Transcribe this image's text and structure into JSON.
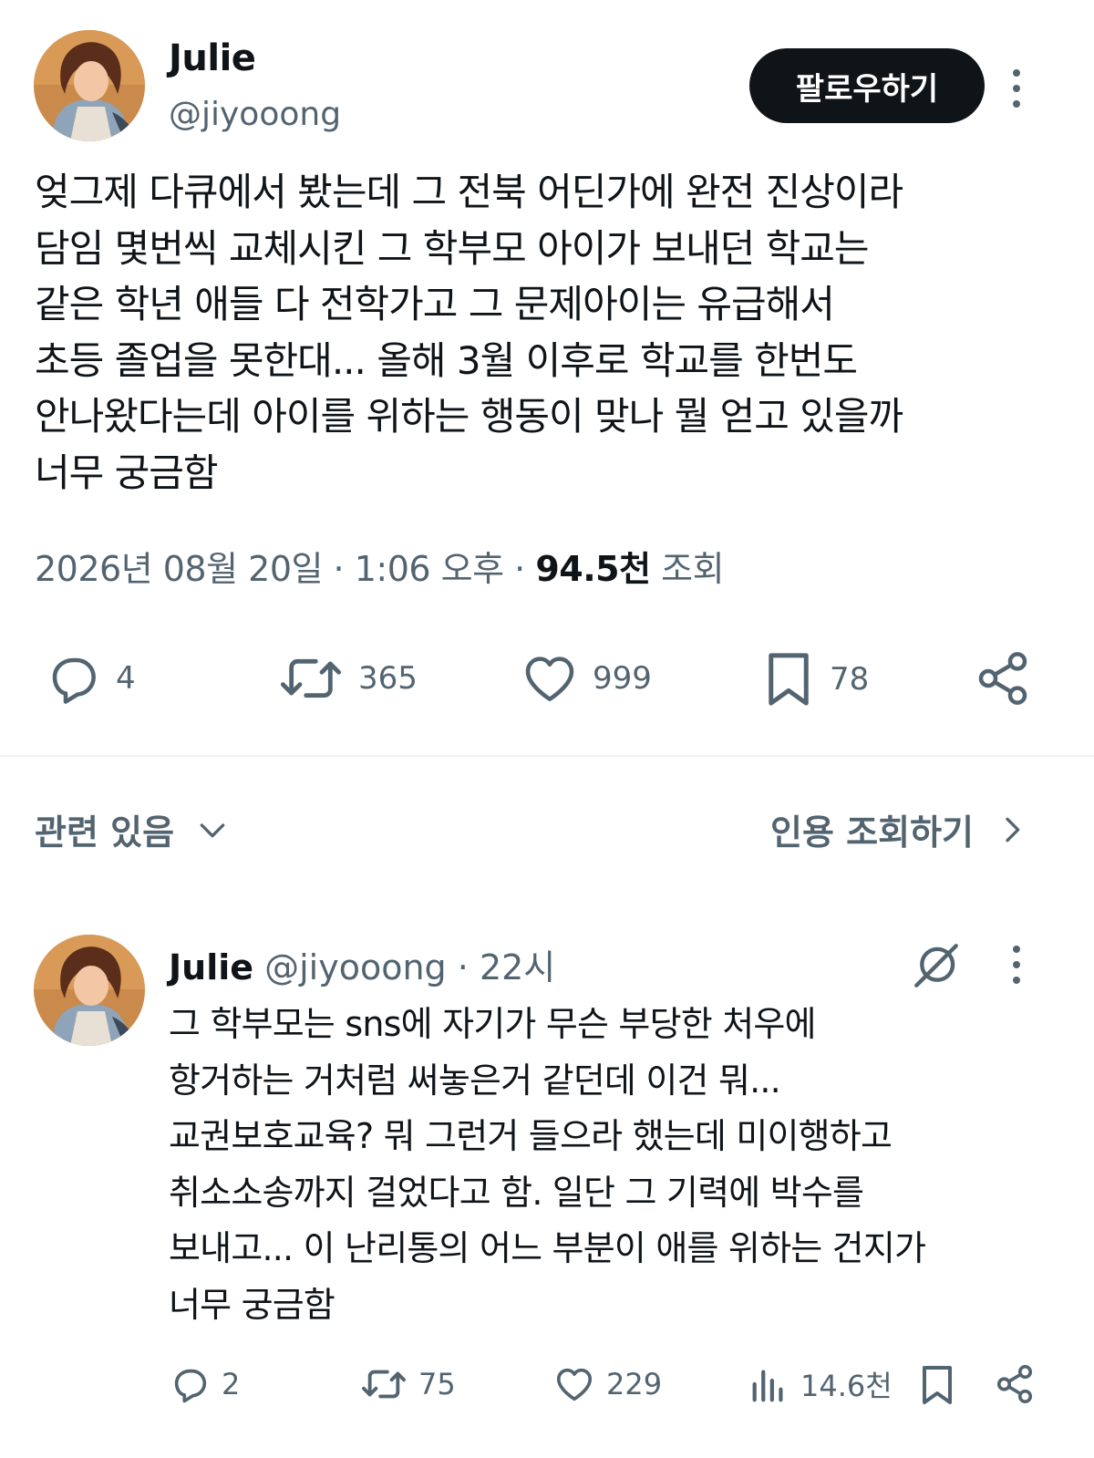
{
  "tweet": {
    "author_name": "Julie",
    "author_handle": "@jiyooong",
    "follow_label": "팔로우하기",
    "text": "엊그제 다큐에서 봤는데 그 전북 어딘가에 완전 진상이라\n담임 몇번씩 교체시킨 그 학부모 아이가 보내던 학교는\n같은 학년 애들 다 전학가고 그 문제아이는 유급해서\n초등 졸업을 못한대... 올해 3월 이후로 학교를 한번도\n안나왔다는데 아이를 위하는 행동이 맞나 뭘 얻고 있을까\n너무 궁금함",
    "date": "2026년 08월 20일",
    "time": "1:06 오후",
    "views_count": "94.5천",
    "views_label": "조회",
    "replies": "4",
    "retweets": "365",
    "likes": "999",
    "bookmarks": "78"
  },
  "related": {
    "label": "관련 있음",
    "quote_label": "인용 조회하기"
  },
  "reply": {
    "author_name": "Julie",
    "author_handle": "@jiyooong",
    "time": "22시",
    "text": "그 학부모는 sns에 자기가 무슨 부당한 처우에\n항거하는 거처럼 써놓은거 같던데 이건 뭐...\n교권보호교육? 뭐 그런거 들으라 했는데 미이행하고\n취소소송까지 걸었다고 함. 일단 그 기력에 박수를\n보내고... 이 난리통의 어느 부분이 애를 위하는 건지가\n너무 궁금함",
    "replies": "2",
    "retweets": "75",
    "likes": "229",
    "views": "14.6천"
  },
  "icons": [
    "avatar",
    "more-icon",
    "reply-icon",
    "retweet-icon",
    "like-icon",
    "bookmark-icon",
    "share-icon",
    "chevron-down-icon",
    "chevron-right-icon",
    "grok-icon",
    "views-icon"
  ],
  "colors": {
    "text": "#0f1419",
    "secondary": "#536471",
    "button_bg": "#0f1419",
    "divider": "#eff3f4"
  }
}
